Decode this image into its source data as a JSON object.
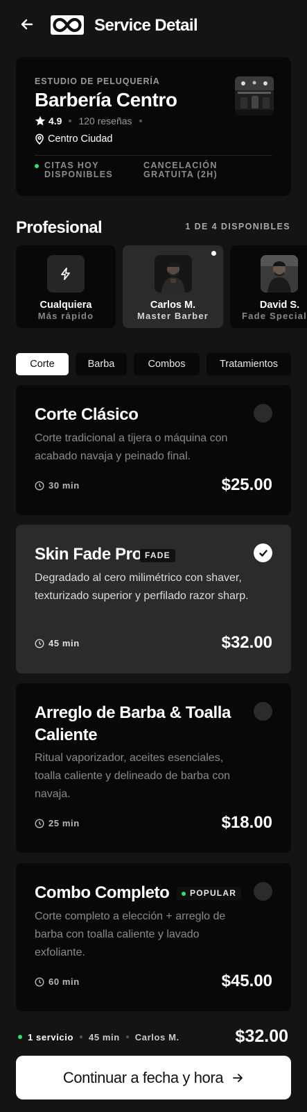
{
  "header": {
    "title": "Service Detail",
    "back_icon": "arrow-left-icon",
    "logo_icon": "infinity-logo"
  },
  "shop": {
    "kicker": "ESTUDIO DE PELUQUERÍA",
    "name": "Barbería Centro",
    "rating": "4.9",
    "reviews": "120 reseñas",
    "location": "Centro Ciudad",
    "info_left_line1": "CITAS HOY",
    "info_left_line2": "DISPONIBLES",
    "info_right_line1": "CANCELACIÓN",
    "info_right_line2": "GRATUITA (2H)"
  },
  "professionals": {
    "title": "Profesional",
    "count": "1 DE 4 DISPONIBLES",
    "items": [
      {
        "name": "Cualquiera",
        "role": "Más rápido",
        "icon": "lightning-icon",
        "selected": false
      },
      {
        "name": "Carlos M.",
        "role": "Master Barber",
        "selected": true
      },
      {
        "name": "David S.",
        "role": "Fade Speciali",
        "selected": false
      }
    ]
  },
  "tabs": [
    {
      "label": "Corte",
      "active": true
    },
    {
      "label": "Barba",
      "active": false
    },
    {
      "label": "Combos",
      "active": false
    },
    {
      "label": "Tratamientos",
      "active": false
    }
  ],
  "services": [
    {
      "name": "Corte Clásico",
      "description": "Corte tradicional a tijera o máquina con acabado navaja y peinado final.",
      "duration": "30 min",
      "price": "$25.00",
      "selected": false,
      "badge": ""
    },
    {
      "name": "Skin Fade Pro",
      "description": "Degradado al cero milimétrico con shaver, texturizado superior y perfilado razor sharp.",
      "duration": "45 min",
      "price": "$32.00",
      "selected": true,
      "badge": "FADE"
    },
    {
      "name": "Arreglo de Barba & Toalla Caliente",
      "description": "Ritual vaporizador, aceites esenciales, toalla caliente y delineado de barba con navaja.",
      "duration": "25 min",
      "price": "$18.00",
      "selected": false,
      "badge": ""
    },
    {
      "name": "Combo Completo",
      "description": "Corte completo a elección + arreglo de barba con toalla caliente y lavado exfoliante.",
      "duration": "60 min",
      "price": "$45.00",
      "selected": false,
      "badge": "POPULAR"
    }
  ],
  "summary": {
    "services": "1 servicio",
    "duration": "45 min",
    "professional": "Carlos M.",
    "total": "$32.00"
  },
  "cta": {
    "label": "Continuar a fecha y hora",
    "icon": "arrow-right-icon"
  },
  "colors": {
    "background": "#141414",
    "card": "#080808",
    "card_selected": "#2b2b2b",
    "accent_green": "#2ee36b"
  }
}
